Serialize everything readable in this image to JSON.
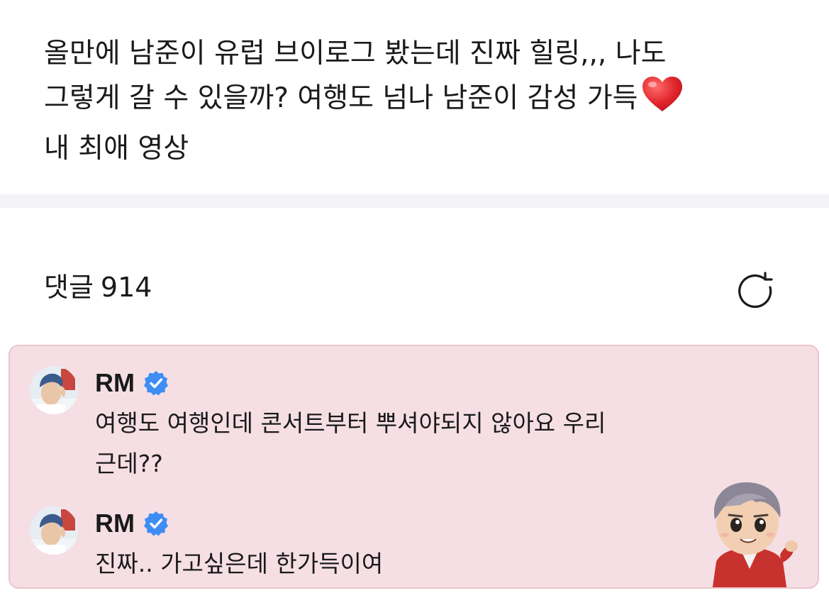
{
  "post": {
    "text_line1": "올만에 남준이 유럽 브이로그 봤는데 진짜 힐링,,, 나도",
    "text_line2": "그렇게 갈 수 있을까? 여행도 넘나 남준이 감성 가득",
    "text_line3": "내 최애 영상",
    "emoji": "heart"
  },
  "comments_header": {
    "label": "댓글",
    "count": "914",
    "refresh_icon": "refresh-icon"
  },
  "artist_comments": [
    {
      "author": "RM",
      "verified": true,
      "text": "여행도 여행인데 콘서트부터 뿌셔야되지 않아요 우리\n근데??"
    },
    {
      "author": "RM",
      "verified": true,
      "text": "진짜.. 가고싶은데 한가득이여"
    }
  ],
  "colors": {
    "artist_box_bg": "#f5dfe4",
    "artist_box_border": "#ecc4cd",
    "verified_blue": "#3d8df5",
    "heart_red": "#e0242b",
    "divider": "#f4f4f8"
  }
}
